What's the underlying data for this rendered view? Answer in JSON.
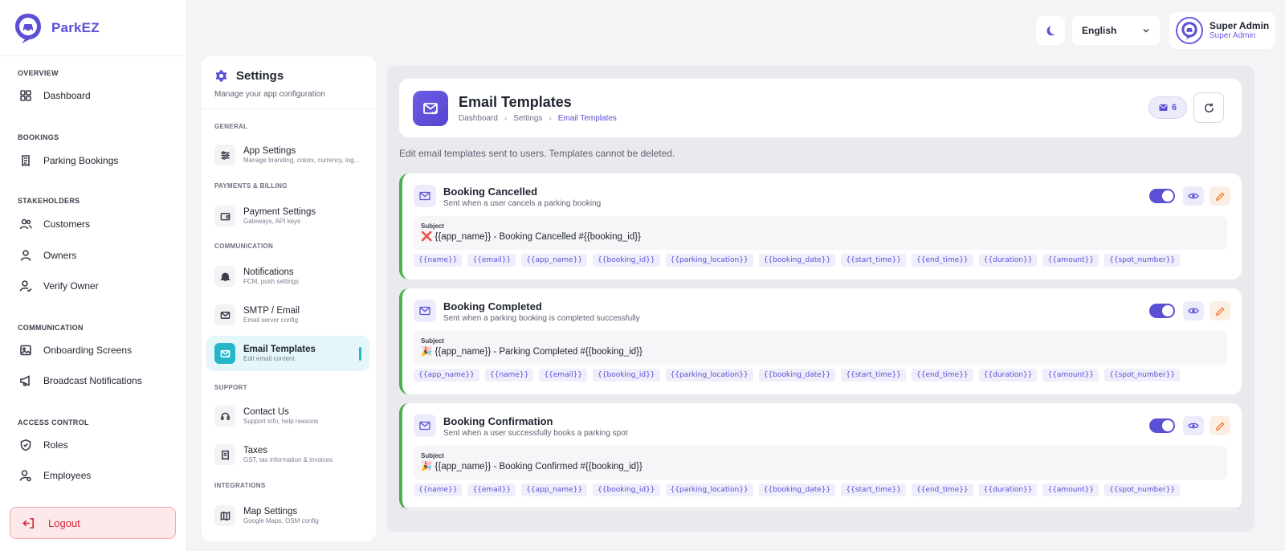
{
  "brand": {
    "name": "ParkEZ"
  },
  "sidebar": {
    "sections": [
      {
        "title": "OVERVIEW",
        "items": [
          {
            "label": "Dashboard",
            "icon": "grid-icon"
          }
        ]
      },
      {
        "title": "BOOKINGS",
        "items": [
          {
            "label": "Parking Bookings",
            "icon": "receipt-icon"
          }
        ]
      },
      {
        "title": "STAKEHOLDERS",
        "items": [
          {
            "label": "Customers",
            "icon": "users-icon"
          },
          {
            "label": "Owners",
            "icon": "user-icon"
          },
          {
            "label": "Verify Owner",
            "icon": "user-check-icon"
          }
        ]
      },
      {
        "title": "COMMUNICATION",
        "items": [
          {
            "label": "Onboarding Screens",
            "icon": "image-icon"
          },
          {
            "label": "Broadcast Notifications",
            "icon": "megaphone-icon"
          }
        ]
      },
      {
        "title": "ACCESS CONTROL",
        "items": [
          {
            "label": "Roles",
            "icon": "shield-icon"
          },
          {
            "label": "Employees",
            "icon": "user-gear-icon"
          }
        ]
      }
    ],
    "logout_label": "Logout"
  },
  "topbar": {
    "language": "English",
    "user_name": "Super Admin",
    "user_role": "Super Admin"
  },
  "settings": {
    "title": "Settings",
    "subtitle": "Manage your app configuration",
    "sections": [
      {
        "title": "GENERAL",
        "items": [
          {
            "label": "App Settings",
            "desc": "Manage branding, colors, currency, log..."
          }
        ]
      },
      {
        "title": "PAYMENTS & BILLING",
        "items": [
          {
            "label": "Payment Settings",
            "desc": "Gateways, API keys"
          }
        ]
      },
      {
        "title": "COMMUNICATION",
        "items": [
          {
            "label": "Notifications",
            "desc": "FCM, push settings"
          },
          {
            "label": "SMTP / Email",
            "desc": "Email server config"
          },
          {
            "label": "Email Templates",
            "desc": "Edit email content",
            "active": true
          }
        ]
      },
      {
        "title": "SUPPORT",
        "items": [
          {
            "label": "Contact Us",
            "desc": "Support info, help reasons"
          },
          {
            "label": "Taxes",
            "desc": "GST, tax information & invoices"
          }
        ]
      },
      {
        "title": "INTEGRATIONS",
        "items": [
          {
            "label": "Map Settings",
            "desc": "Google Maps, OSM config"
          }
        ]
      }
    ]
  },
  "page": {
    "title": "Email Templates",
    "breadcrumb": [
      "Dashboard",
      "Settings",
      "Email Templates"
    ],
    "count": "6",
    "intro": "Edit email templates sent to users. Templates cannot be deleted.",
    "subject_label": "Subject",
    "accent_color": "#5b4fd6",
    "card_border_color": "#4caf50"
  },
  "templates": [
    {
      "title": "Booking Cancelled",
      "desc": "Sent when a user cancels a parking booking",
      "subject": "❌ {{app_name}} - Booking Cancelled #{{booking_id}}",
      "enabled": true,
      "vars": [
        "{{name}}",
        "{{email}}",
        "{{app_name}}",
        "{{booking_id}}",
        "{{parking_location}}",
        "{{booking_date}}",
        "{{start_time}}",
        "{{end_time}}",
        "{{duration}}",
        "{{amount}}",
        "{{spot_number}}"
      ]
    },
    {
      "title": "Booking Completed",
      "desc": "Sent when a parking booking is completed successfully",
      "subject": "🎉 {{app_name}} - Parking Completed #{{booking_id}}",
      "enabled": true,
      "vars": [
        "{{app_name}}",
        "{{name}}",
        "{{email}}",
        "{{booking_id}}",
        "{{parking_location}}",
        "{{booking_date}}",
        "{{start_time}}",
        "{{end_time}}",
        "{{duration}}",
        "{{amount}}",
        "{{spot_number}}"
      ]
    },
    {
      "title": "Booking Confirmation",
      "desc": "Sent when a user successfully books a parking spot",
      "subject": "🎉 {{app_name}} - Booking Confirmed #{{booking_id}}",
      "enabled": true,
      "vars": [
        "{{name}}",
        "{{email}}",
        "{{app_name}}",
        "{{booking_id}}",
        "{{parking_location}}",
        "{{booking_date}}",
        "{{start_time}}",
        "{{end_time}}",
        "{{duration}}",
        "{{amount}}",
        "{{spot_number}}"
      ]
    }
  ]
}
